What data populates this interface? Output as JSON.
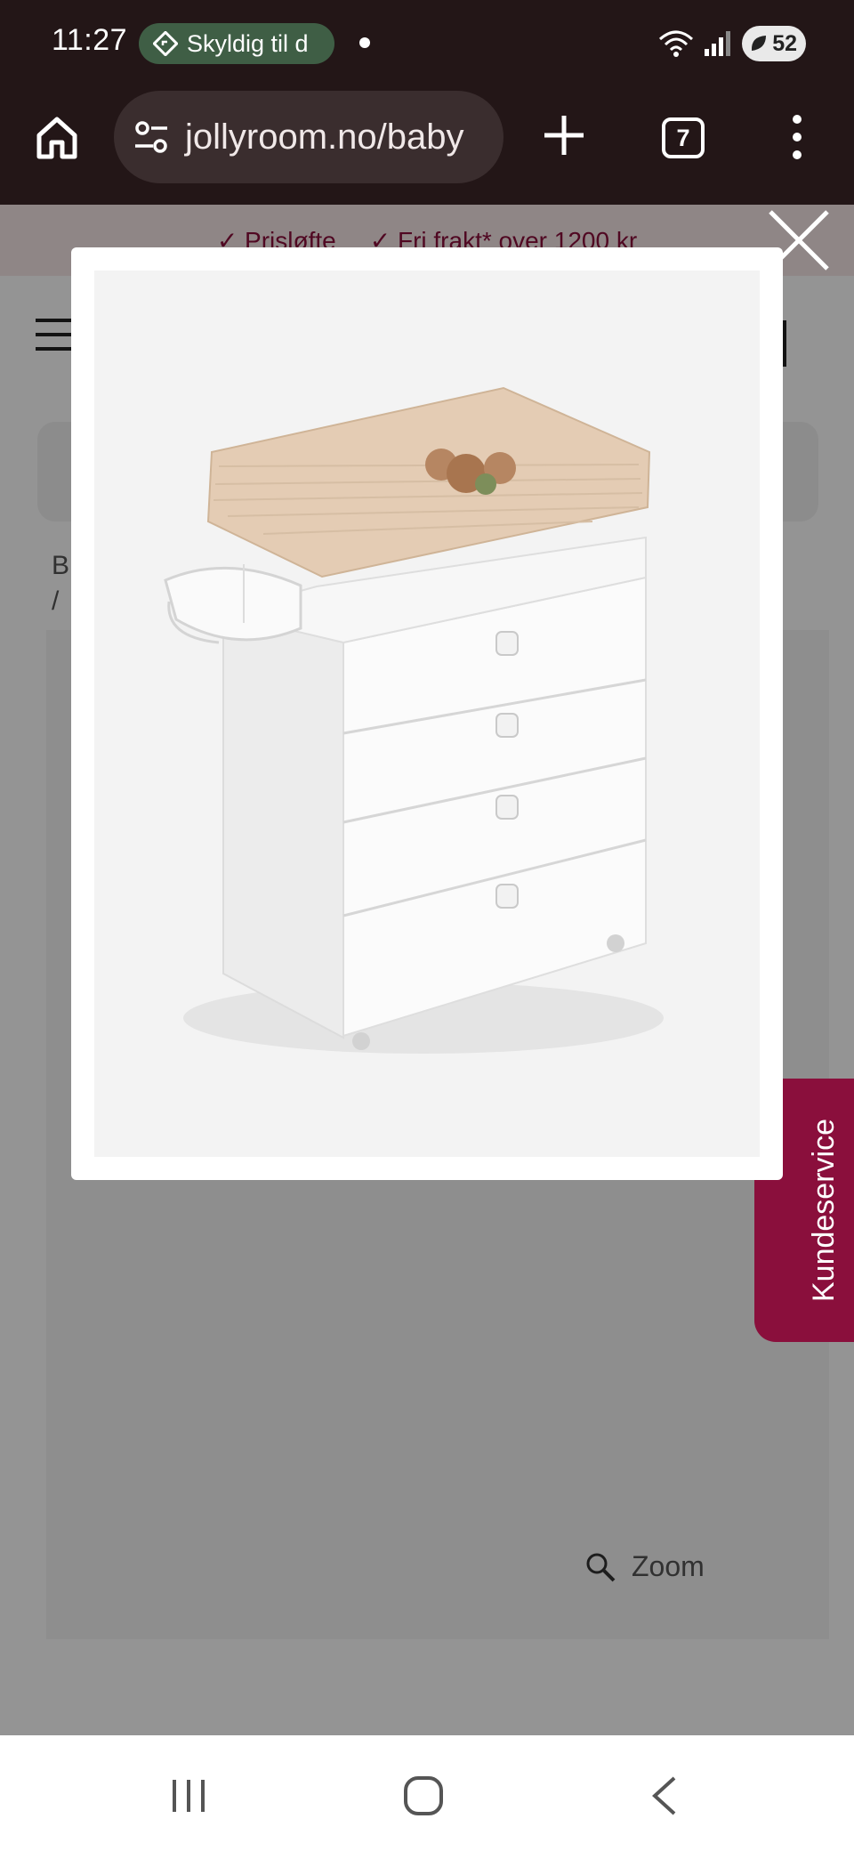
{
  "status_bar": {
    "time": "11:27",
    "notification_pill": "Skyldig til d",
    "battery": "52"
  },
  "browser": {
    "url": "jollyroom.no/baby",
    "tab_count": "7"
  },
  "page": {
    "promo": [
      "✓ Prisløfte",
      "✓ Fri frakt* over 1200 kr"
    ],
    "breadcrumb_lines": [
      "B",
      "/"
    ],
    "zoom_label": "Zoom",
    "customer_service_label": "Kundeservice"
  },
  "icons": {
    "home": "home-icon",
    "site_settings": "tune-icon",
    "new_tab": "plus-icon",
    "menu": "more-vert-icon",
    "close": "close-icon",
    "zoom": "magnifier-icon",
    "nav_recents": "recents-icon",
    "nav_home": "home-circle-icon",
    "nav_back": "back-icon"
  },
  "colors": {
    "browser_chrome": "#231617",
    "brand_accent": "#8a0f3c",
    "promo_background": "#f6e7e7",
    "status_pill": "#3f5e45"
  }
}
